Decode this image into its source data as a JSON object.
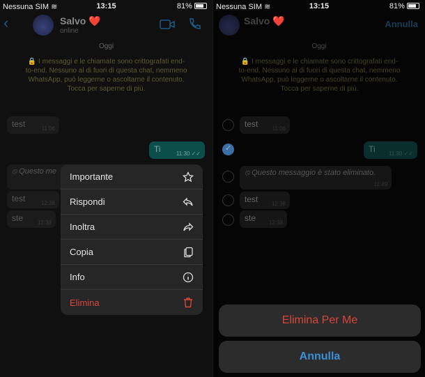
{
  "status": {
    "carrier": "Nessuna SIM",
    "time": "13:15",
    "battery": "81%"
  },
  "chat": {
    "contact": "Salvo",
    "heart": "❤️",
    "presence": "online",
    "date": "Oggi",
    "encryption": "🔒 I messaggi e le chiamate sono crittografati end-to-end. Nessuno al di fuori di questa chat, nemmeno WhatsApp, può leggerne o ascoltarne il contenuto. Tocca per saperne di più.",
    "messages": [
      {
        "text": "test",
        "time": "11:06",
        "dir": "in"
      },
      {
        "text": "Ti",
        "time": "11:30",
        "dir": "out"
      },
      {
        "text": "⦸ Questo messaggio è stato eliminato.",
        "short": "⦸ Questo me",
        "time": "11:49",
        "dir": "in"
      },
      {
        "text": "test",
        "time": "12:38",
        "dir": "in"
      },
      {
        "text": "ste",
        "time": "12:38",
        "dir": "in"
      }
    ]
  },
  "menu": [
    {
      "label": "Importante",
      "icon": "star-icon"
    },
    {
      "label": "Rispondi",
      "icon": "reply-icon"
    },
    {
      "label": "Inoltra",
      "icon": "forward-icon"
    },
    {
      "label": "Copia",
      "icon": "copy-icon"
    },
    {
      "label": "Info",
      "icon": "info-icon"
    },
    {
      "label": "Elimina",
      "icon": "trash-icon"
    }
  ],
  "selection": {
    "cancel_header": "Annulla",
    "delete_for_me": "Elimina Per Me",
    "cancel": "Annulla",
    "selected_index": 1
  },
  "colors": {
    "accent": "#3b8fd9",
    "danger": "#d9473b",
    "outgoing": "#0c4e49"
  }
}
